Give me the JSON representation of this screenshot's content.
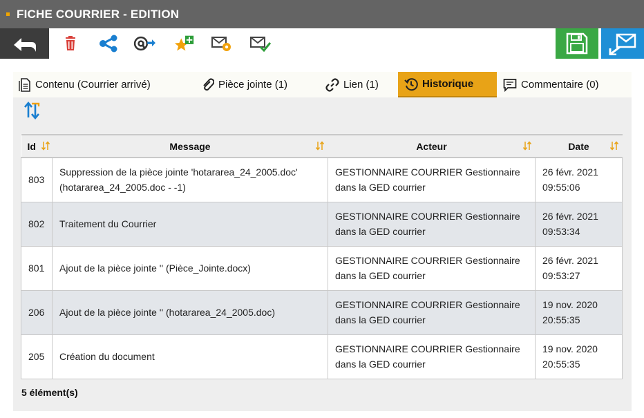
{
  "window": {
    "title": "FICHE COURRIER - EDITION"
  },
  "toolbar": {
    "icons": [
      "back-arrow-icon",
      "trash-icon",
      "share-icon",
      "at-forward-icon",
      "star-add-icon",
      "mail-settings-icon",
      "mail-check-icon",
      "save-icon",
      "send-mail-icon"
    ],
    "colors": {
      "back_bg": "#3c3c3c",
      "save_bg": "#3aa844",
      "send_bg": "#1e8fd6",
      "accent": "#e8a317"
    }
  },
  "tabs": [
    {
      "label": "Contenu (Courrier arrivé)",
      "icon": "document-icon",
      "active": false
    },
    {
      "label": "Pièce jointe (1)",
      "icon": "paperclip-icon",
      "active": false
    },
    {
      "label": "Lien (1)",
      "icon": "link-icon",
      "active": false
    },
    {
      "label": "Historique",
      "icon": "history-icon",
      "active": true
    },
    {
      "label": "Commentaire (0)",
      "icon": "comment-icon",
      "active": false
    }
  ],
  "table": {
    "columns": [
      "Id",
      "Message",
      "Acteur",
      "Date"
    ],
    "rows": [
      {
        "id": "803",
        "message": "Suppression de la pièce jointe 'hotararea_24_2005.doc' (hotararea_24_2005.doc - -1)",
        "actor": "GESTIONNAIRE COURRIER Gestionnaire dans la GED courrier",
        "date": "26 févr. 2021",
        "time": "09:55:06"
      },
      {
        "id": "802",
        "message": "Traitement du Courrier",
        "actor": "GESTIONNAIRE COURRIER Gestionnaire dans la GED courrier",
        "date": "26 févr. 2021",
        "time": "09:53:34"
      },
      {
        "id": "801",
        "message": "Ajout de la pièce jointe '' (Pièce_Jointe.docx)",
        "actor": "GESTIONNAIRE COURRIER Gestionnaire dans la GED courrier",
        "date": "26 févr. 2021",
        "time": "09:53:27"
      },
      {
        "id": "206",
        "message": "Ajout de la pièce jointe '' (hotararea_24_2005.doc)",
        "actor": "GESTIONNAIRE COURRIER Gestionnaire dans la GED courrier",
        "date": "19 nov. 2020",
        "time": "20:55:35"
      },
      {
        "id": "205",
        "message": "Création du document",
        "actor": "GESTIONNAIRE COURRIER Gestionnaire dans la GED courrier",
        "date": "19 nov. 2020",
        "time": "20:55:35"
      }
    ],
    "footer": "5 élément(s)"
  }
}
